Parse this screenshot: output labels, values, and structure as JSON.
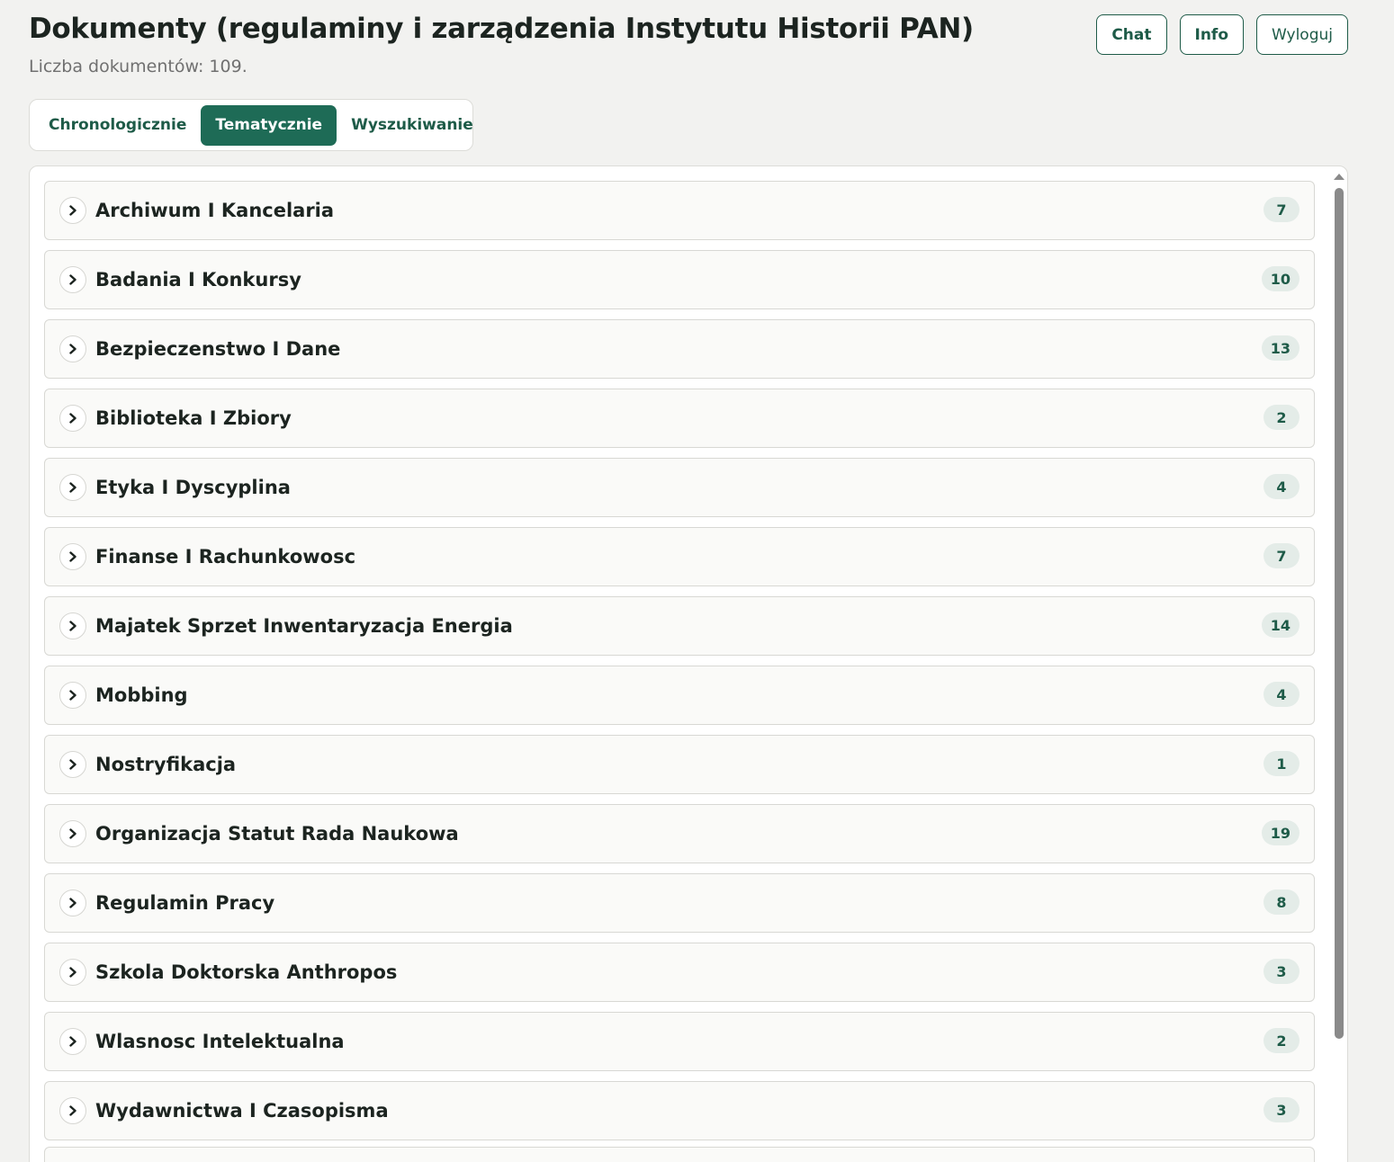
{
  "header": {
    "title": "Dokumenty (regulaminy i zarządzenia Instytutu Historii PAN)",
    "subtitle": "Liczba dokumentów: 109."
  },
  "actions": {
    "chat": "Chat",
    "info": "Info",
    "logout": "Wyloguj"
  },
  "tabs": [
    {
      "label": "Chronologicznie",
      "active": false
    },
    {
      "label": "Tematycznie",
      "active": true
    },
    {
      "label": "Wyszukiwanie",
      "active": false
    }
  ],
  "categories": [
    {
      "label": "Archiwum I Kancelaria",
      "count": "7"
    },
    {
      "label": "Badania I Konkursy",
      "count": "10"
    },
    {
      "label": "Bezpieczenstwo I Dane",
      "count": "13"
    },
    {
      "label": "Biblioteka I Zbiory",
      "count": "2"
    },
    {
      "label": "Etyka I Dyscyplina",
      "count": "4"
    },
    {
      "label": "Finanse I Rachunkowosc",
      "count": "7"
    },
    {
      "label": "Majatek Sprzet Inwentaryzacja Energia",
      "count": "14"
    },
    {
      "label": "Mobbing",
      "count": "4"
    },
    {
      "label": "Nostryfikacja",
      "count": "1"
    },
    {
      "label": "Organizacja Statut Rada Naukowa",
      "count": "19"
    },
    {
      "label": "Regulamin Pracy",
      "count": "8"
    },
    {
      "label": "Szkola Doktorska Anthropos",
      "count": "3"
    },
    {
      "label": "Wlasnosc Intelektualna",
      "count": "2"
    },
    {
      "label": "Wydawnictwa I Czasopisma",
      "count": "3"
    }
  ],
  "icons": {
    "expand": "chevron-right-icon"
  },
  "colors": {
    "accent": "#1e6b56",
    "accent_text": "#1e5b48",
    "badge_bg": "#e4ece8",
    "page_bg": "#f2f2f0"
  }
}
